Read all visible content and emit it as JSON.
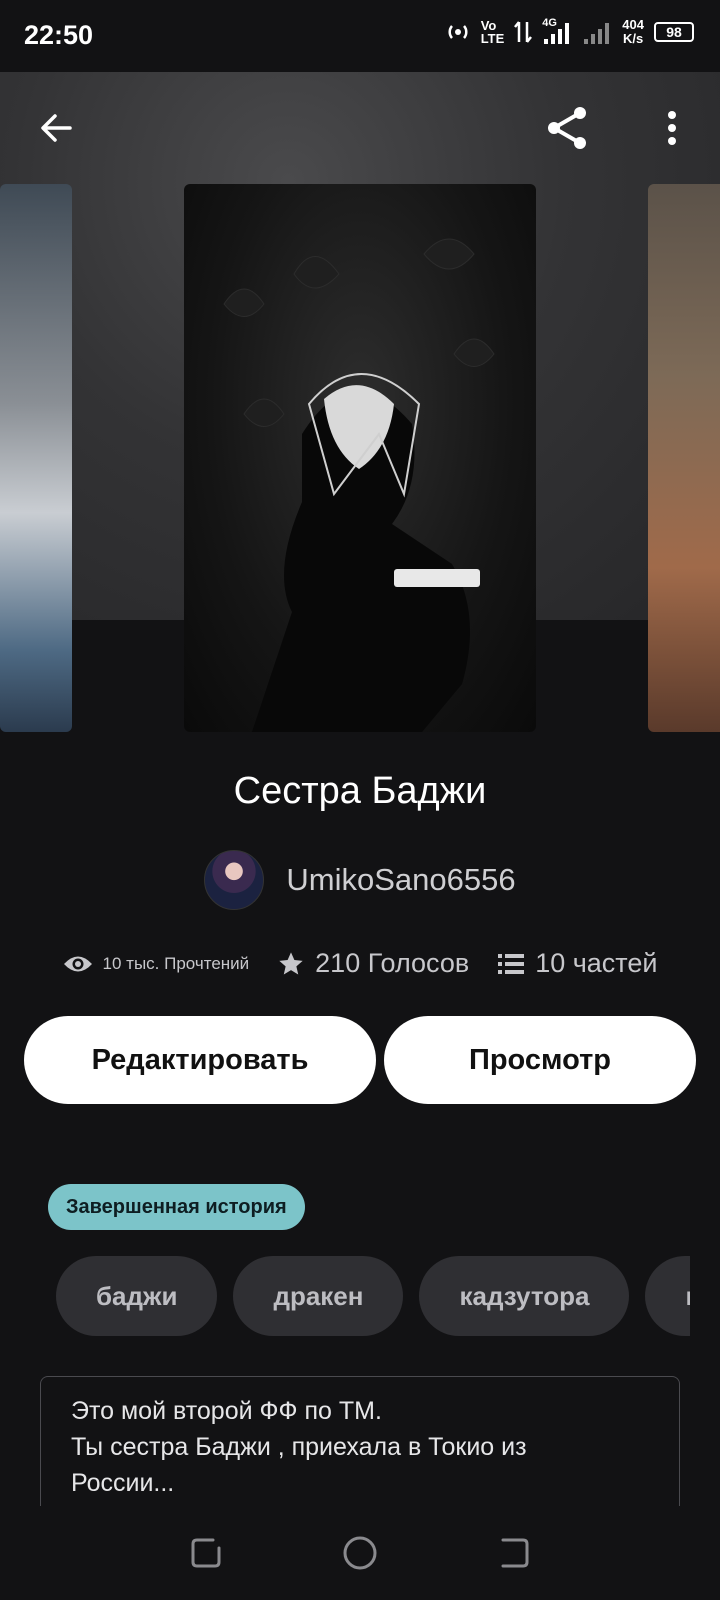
{
  "status_bar": {
    "time": "22:50",
    "network_volte_top": "Vo",
    "network_volte_bottom": "LTE",
    "network_type": "4G",
    "speed_top": "404",
    "speed_bottom": "K/s",
    "battery_level": "98"
  },
  "app_bar": {
    "back_icon": "arrow-left-icon",
    "share_icon": "share-icon",
    "menu_icon": "more-vertical-icon"
  },
  "story": {
    "title": "Сестра Баджи",
    "author": "UmikoSano6556",
    "reads": "10 тыс. Прочтений",
    "votes": "210 Голосов",
    "parts": "10 частей",
    "status_badge": "Завершенная история",
    "tags": [
      "баджи",
      "дракен",
      "кадзутора",
      "кисаки"
    ],
    "description_lines": [
      "Это мой второй ФФ по ТМ.",
      "Ты сестра Баджи , приехала в Токио из",
      "России..."
    ]
  },
  "actions": {
    "edit_label": "Редактировать",
    "view_label": "Просмотр"
  },
  "colors": {
    "background": "#121214",
    "badge": "#7cc4c9",
    "tag_bg": "#2f2f33",
    "button_bg": "#ffffff"
  }
}
